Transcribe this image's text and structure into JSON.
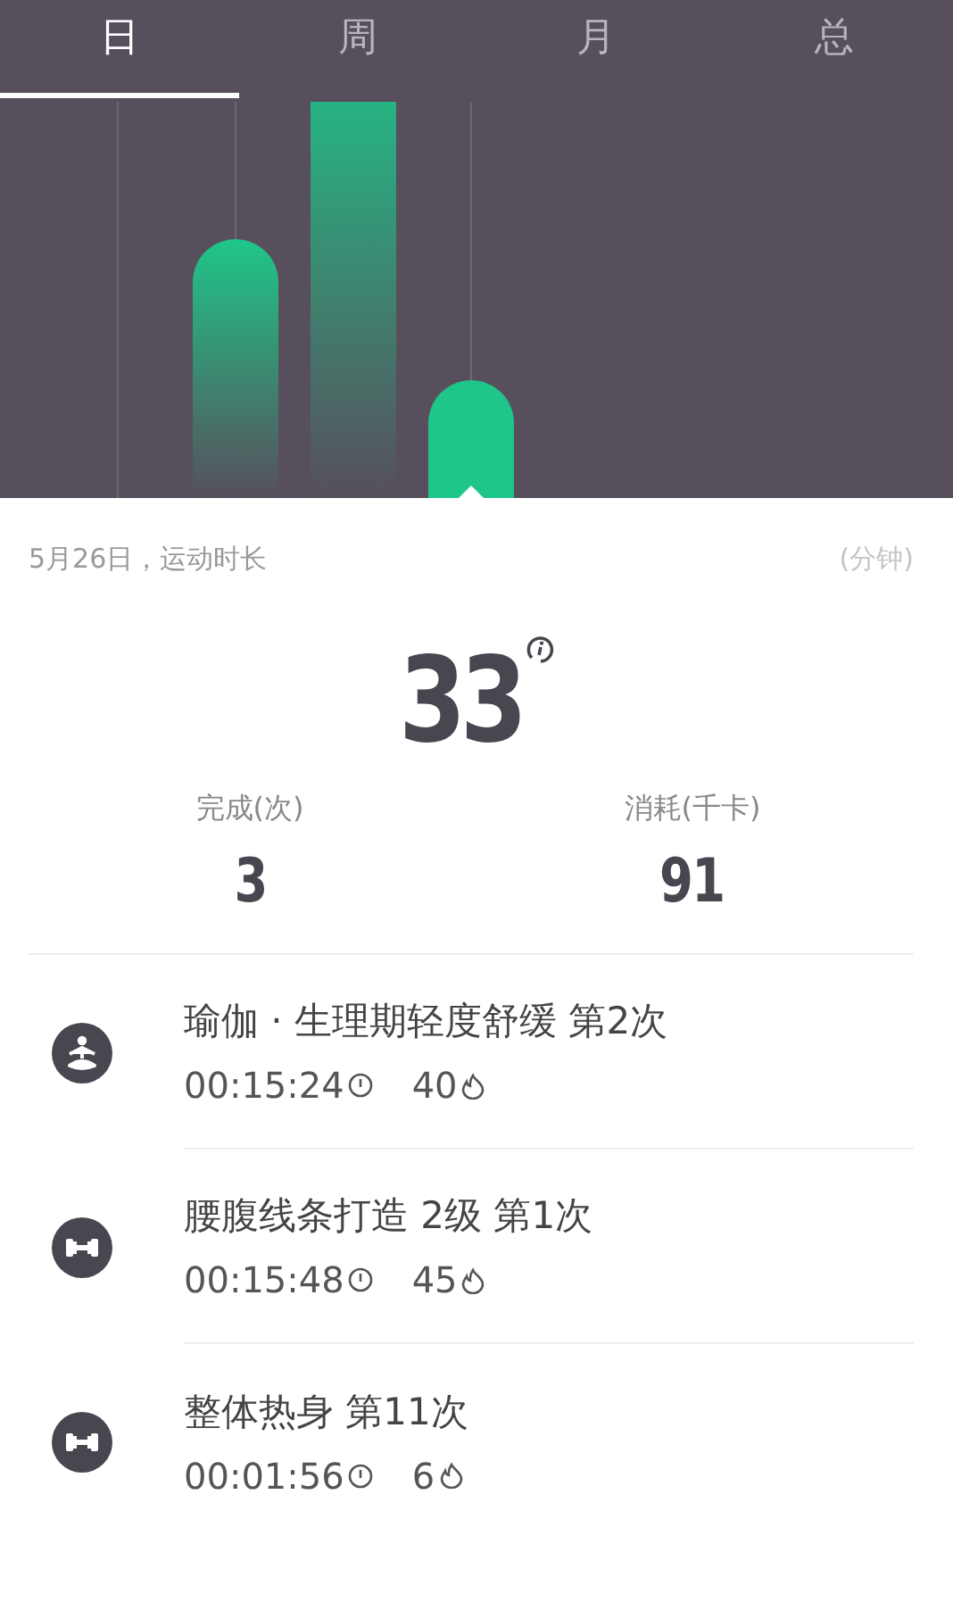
{
  "tabs": [
    {
      "label": "日",
      "selected": true
    },
    {
      "label": "周",
      "selected": false
    },
    {
      "label": "月",
      "selected": false
    },
    {
      "label": "总",
      "selected": false
    }
  ],
  "summary": {
    "date_label": "5月26日，运动时长",
    "unit": "(分钟)",
    "total": "33"
  },
  "stats": [
    {
      "label": "完成(次)",
      "value": "3"
    },
    {
      "label": "消耗(千卡)",
      "value": "91"
    }
  ],
  "activities": [
    {
      "kind": "yoga",
      "title": "瑜伽 · 生理期轻度舒缓 第2次",
      "duration": "00:15:24",
      "calories": "40"
    },
    {
      "kind": "strength",
      "title": "腰腹线条打造 2级 第1次",
      "duration": "00:15:48",
      "calories": "45"
    },
    {
      "kind": "strength",
      "title": "整体热身 第11次",
      "duration": "00:01:56",
      "calories": "6"
    }
  ]
}
